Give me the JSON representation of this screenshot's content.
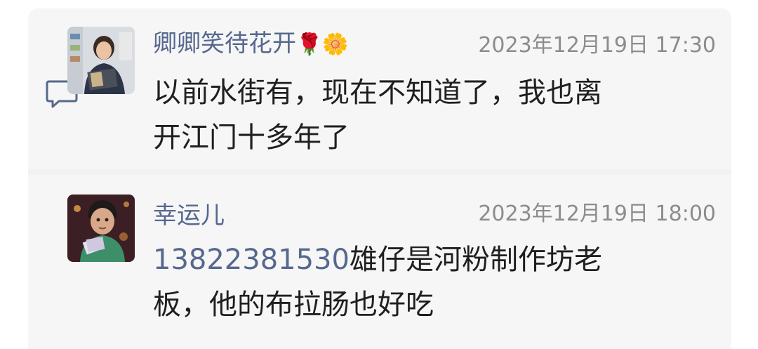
{
  "comments": [
    {
      "author": "卿卿笑待花开",
      "author_emojis": [
        "🌹",
        "🌼"
      ],
      "timestamp": "2023年12月19日 17:30",
      "text": "以前水街有，现在不知道了，我也离开江门十多年了",
      "text_lines": [
        "以前水街有，现在不知道了，我也离",
        "开江门十多年了"
      ],
      "avatar": "avatar-person-reading-book"
    },
    {
      "author": "幸运儿",
      "timestamp": "2023年12月19日 18:00",
      "mention": "13822381530",
      "text": "雄仔是河粉制作坊老板，他的布拉肠也好吃",
      "text_lines": [
        "雄仔是河粉制作坊老",
        "板，他的布拉肠也好吃"
      ],
      "avatar": "avatar-cartoon-character"
    }
  ],
  "icons": {
    "reply": "comment-bubble-icon"
  },
  "colors": {
    "author": "#56688e",
    "timestamp": "#8c8c8c",
    "body": "#1f1f1f",
    "panel": "#f6f6f6"
  }
}
